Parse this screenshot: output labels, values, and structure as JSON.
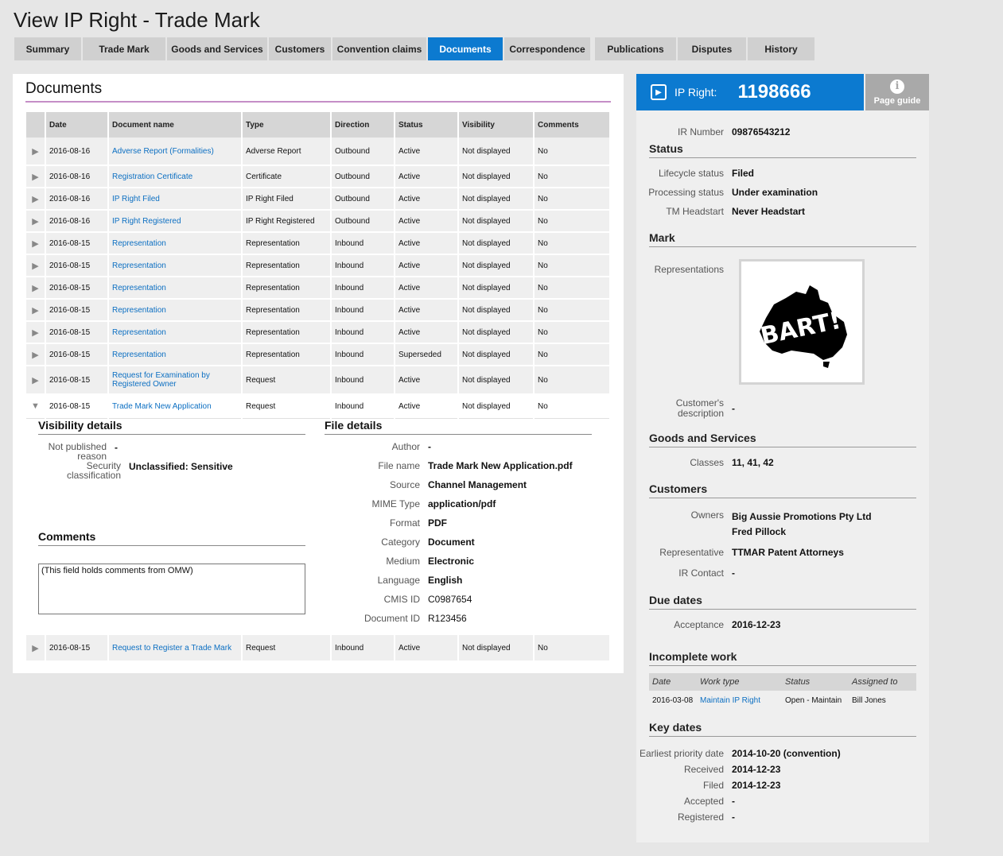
{
  "page": {
    "title": "View IP Right - Trade Mark"
  },
  "tabs": [
    {
      "label": "Summary"
    },
    {
      "label": "Trade Mark"
    },
    {
      "label": "Goods and Services"
    },
    {
      "label": "Customers"
    },
    {
      "label": "Convention claims"
    },
    {
      "label": "Documents",
      "active": true
    },
    {
      "label": "Correspondence"
    },
    {
      "label": "Publications"
    },
    {
      "label": "Disputes"
    },
    {
      "label": "History"
    }
  ],
  "documents": {
    "title": "Documents",
    "columns": [
      "Date",
      "Document name",
      "Type",
      "Direction",
      "Status",
      "Visibility",
      "Comments"
    ],
    "rows": [
      {
        "date": "2016-08-16",
        "name": "Adverse Report (Formalities)",
        "type": "Adverse Report",
        "direction": "Outbound",
        "status": "Active",
        "visibility": "Not displayed",
        "comments": "No"
      },
      {
        "date": "2016-08-16",
        "name": "Registration Certificate",
        "type": "Certificate",
        "direction": "Outbound",
        "status": "Active",
        "visibility": "Not displayed",
        "comments": "No"
      },
      {
        "date": "2016-08-16",
        "name": "IP Right Filed",
        "type": "IP Right Filed",
        "direction": "Outbound",
        "status": "Active",
        "visibility": "Not displayed",
        "comments": "No"
      },
      {
        "date": "2016-08-16",
        "name": "IP Right Registered",
        "type": "IP Right Registered",
        "direction": "Outbound",
        "status": "Active",
        "visibility": "Not displayed",
        "comments": "No"
      },
      {
        "date": "2016-08-15",
        "name": "Representation",
        "type": "Representation",
        "direction": "Inbound",
        "status": "Active",
        "visibility": "Not displayed",
        "comments": "No"
      },
      {
        "date": "2016-08-15",
        "name": "Representation",
        "type": "Representation",
        "direction": "Inbound",
        "status": "Active",
        "visibility": "Not displayed",
        "comments": "No"
      },
      {
        "date": "2016-08-15",
        "name": "Representation",
        "type": "Representation",
        "direction": "Inbound",
        "status": "Active",
        "visibility": "Not displayed",
        "comments": "No"
      },
      {
        "date": "2016-08-15",
        "name": "Representation",
        "type": "Representation",
        "direction": "Inbound",
        "status": "Active",
        "visibility": "Not displayed",
        "comments": "No"
      },
      {
        "date": "2016-08-15",
        "name": "Representation",
        "type": "Representation",
        "direction": "Inbound",
        "status": "Active",
        "visibility": "Not displayed",
        "comments": "No"
      },
      {
        "date": "2016-08-15",
        "name": "Representation",
        "type": "Representation",
        "direction": "Inbound",
        "status": "Superseded",
        "visibility": "Not displayed",
        "comments": "No"
      },
      {
        "date": "2016-08-15",
        "name": "Request for Examination by Registered Owner",
        "type": "Request",
        "direction": "Inbound",
        "status": "Active",
        "visibility": "Not displayed",
        "comments": "No"
      },
      {
        "date": "2016-08-15",
        "name": "Trade Mark New Application",
        "type": "Request",
        "direction": "Inbound",
        "status": "Active",
        "visibility": "Not displayed",
        "comments": "No",
        "expanded": true
      }
    ],
    "last_row": {
      "date": "2016-08-15",
      "name": "Request to Register a Trade Mark",
      "type": "Request",
      "direction": "Inbound",
      "status": "Active",
      "visibility": "Not displayed",
      "comments": "No"
    },
    "arrow_collapsed": "▶",
    "arrow_expanded": "▼"
  },
  "visibility_details": {
    "title": "Visibility details",
    "not_published_label": "Not published reason",
    "not_published_value": "-",
    "security_label": "Security classification",
    "security_value": "Unclassified: Sensitive"
  },
  "comments": {
    "title": "Comments",
    "text": "(This field holds comments from OMW)"
  },
  "file_details": {
    "title": "File details",
    "items": [
      {
        "label": "Author",
        "value": "-"
      },
      {
        "label": "File name",
        "value": "Trade Mark New Application.pdf"
      },
      {
        "label": "Source",
        "value": "Channel Management"
      },
      {
        "label": "MIME Type",
        "value": "application/pdf"
      },
      {
        "label": "Format",
        "value": "PDF"
      },
      {
        "label": "Category",
        "value": "Document"
      },
      {
        "label": "Medium",
        "value": "Electronic"
      },
      {
        "label": "Language",
        "value": "English"
      },
      {
        "label": "CMIS ID",
        "value": "C0987654"
      },
      {
        "label": "Document ID",
        "value": "R123456"
      }
    ]
  },
  "side": {
    "ip_label": "IP Right:",
    "ip_number": "1198666",
    "page_guide": "Page guide",
    "ir_number_label": "IR Number",
    "ir_number": "09876543212",
    "status_title": "Status",
    "lifecycle_label": "Lifecycle status",
    "lifecycle": "Filed",
    "processing_label": "Processing status",
    "processing": "Under examination",
    "headstart_label": "TM Headstart",
    "headstart": "Never Headstart",
    "mark_title": "Mark",
    "representations_label": "Representations",
    "mark_logo_text": "BART!",
    "customer_desc_label": "Customer's description",
    "customer_desc": "-",
    "goods_title": "Goods and Services",
    "classes_label": "Classes",
    "classes": "11, 41, 42",
    "customers_title": "Customers",
    "owners_label": "Owners",
    "owner1": "Big Aussie Promotions Pty Ltd",
    "owner2": "Fred Pillock",
    "representative_label": "Representative",
    "representative": "TTMAR Patent Attorneys",
    "ir_contact_label": "IR Contact",
    "ir_contact": "-",
    "due_title": "Due dates",
    "acceptance_label": "Acceptance",
    "acceptance": "2016-12-23",
    "incomplete_title": "Incomplete work",
    "work_columns": [
      "Date",
      "Work type",
      "Status",
      "Assigned to"
    ],
    "work_row": {
      "date": "2016-03-08",
      "type": "Maintain IP Right",
      "status": "Open - Maintain",
      "assigned": "Bill Jones"
    },
    "key_title": "Key dates",
    "key_dates": [
      {
        "label": "Earliest priority date",
        "value": "2014-10-20 (convention)"
      },
      {
        "label": "Received",
        "value": "2014-12-23"
      },
      {
        "label": "Filed",
        "value": "2014-12-23"
      },
      {
        "label": "Accepted",
        "value": "-"
      },
      {
        "label": "Registered",
        "value": "-"
      }
    ]
  },
  "colors": {
    "accent": "#0c7ad0",
    "link": "#0c6fc2",
    "title_underline": "#c58ec7"
  }
}
